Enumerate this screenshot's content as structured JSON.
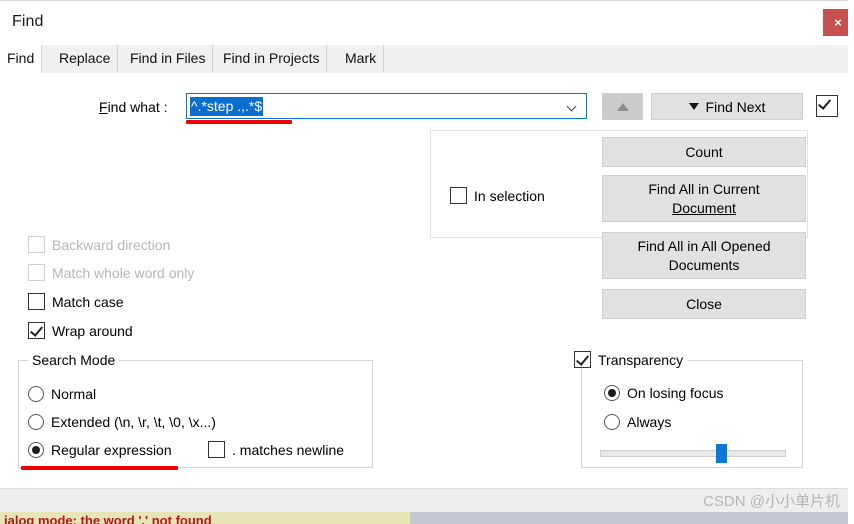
{
  "window": {
    "title": "Find",
    "close_label": "×"
  },
  "tabs": [
    {
      "label": "Find",
      "active": true
    },
    {
      "label": "Replace",
      "active": false
    },
    {
      "label": "Find in Files",
      "active": false
    },
    {
      "label": "Find in Projects",
      "active": false
    },
    {
      "label": "Mark",
      "active": false
    }
  ],
  "find": {
    "label_pre": "F",
    "label_accel": "i",
    "label_post": "nd what :",
    "value": "^.*step .,.*$",
    "dropdown_icon": "chevron-down-icon",
    "up_button_icon": "triangle-up-icon",
    "find_next_icon": "triangle-down-icon",
    "find_next_label": "Find Next",
    "top_right_checkbox_checked": true
  },
  "in_selection": {
    "label": "In selection",
    "checked": false
  },
  "actions": {
    "count": "Count",
    "find_all_current_line1": "Find All in Current",
    "find_all_current_line2": "Document",
    "find_all_all_line1": "Find All in All Opened",
    "find_all_all_line2": "Documents",
    "close": "Close"
  },
  "options": [
    {
      "label": "Backward direction",
      "checked": false,
      "disabled": true
    },
    {
      "label": "Match whole word only",
      "checked": false,
      "disabled": true
    },
    {
      "label": "Match case",
      "checked": false,
      "disabled": false
    },
    {
      "label": "Wrap around",
      "checked": true,
      "disabled": false
    }
  ],
  "search_mode": {
    "legend": "Search Mode",
    "options": [
      {
        "label": "Normal",
        "selected": false
      },
      {
        "label": "Extended (\\n, \\r, \\t, \\0, \\x...)",
        "selected": false
      },
      {
        "label": "Regular expression",
        "selected": true
      }
    ],
    "dot_matches_newline": {
      "label": ". matches newline",
      "checked": false
    }
  },
  "transparency": {
    "label": "Transparency",
    "checked": true,
    "options": [
      {
        "label": "On losing focus",
        "selected": true
      },
      {
        "label": "Always",
        "selected": false
      }
    ],
    "slider_percent": 66
  },
  "watermark": "CSDN @小小单片机",
  "status_bar": {
    "text": "ialog mode: the word '.' not found"
  },
  "colors": {
    "accent": "#0a6ed1",
    "close_button": "#c75050",
    "annotation_red": "#f40000",
    "slider_thumb": "#0a7ad6",
    "status_bg": "#e8e5b4",
    "status_fg": "#b01818"
  }
}
